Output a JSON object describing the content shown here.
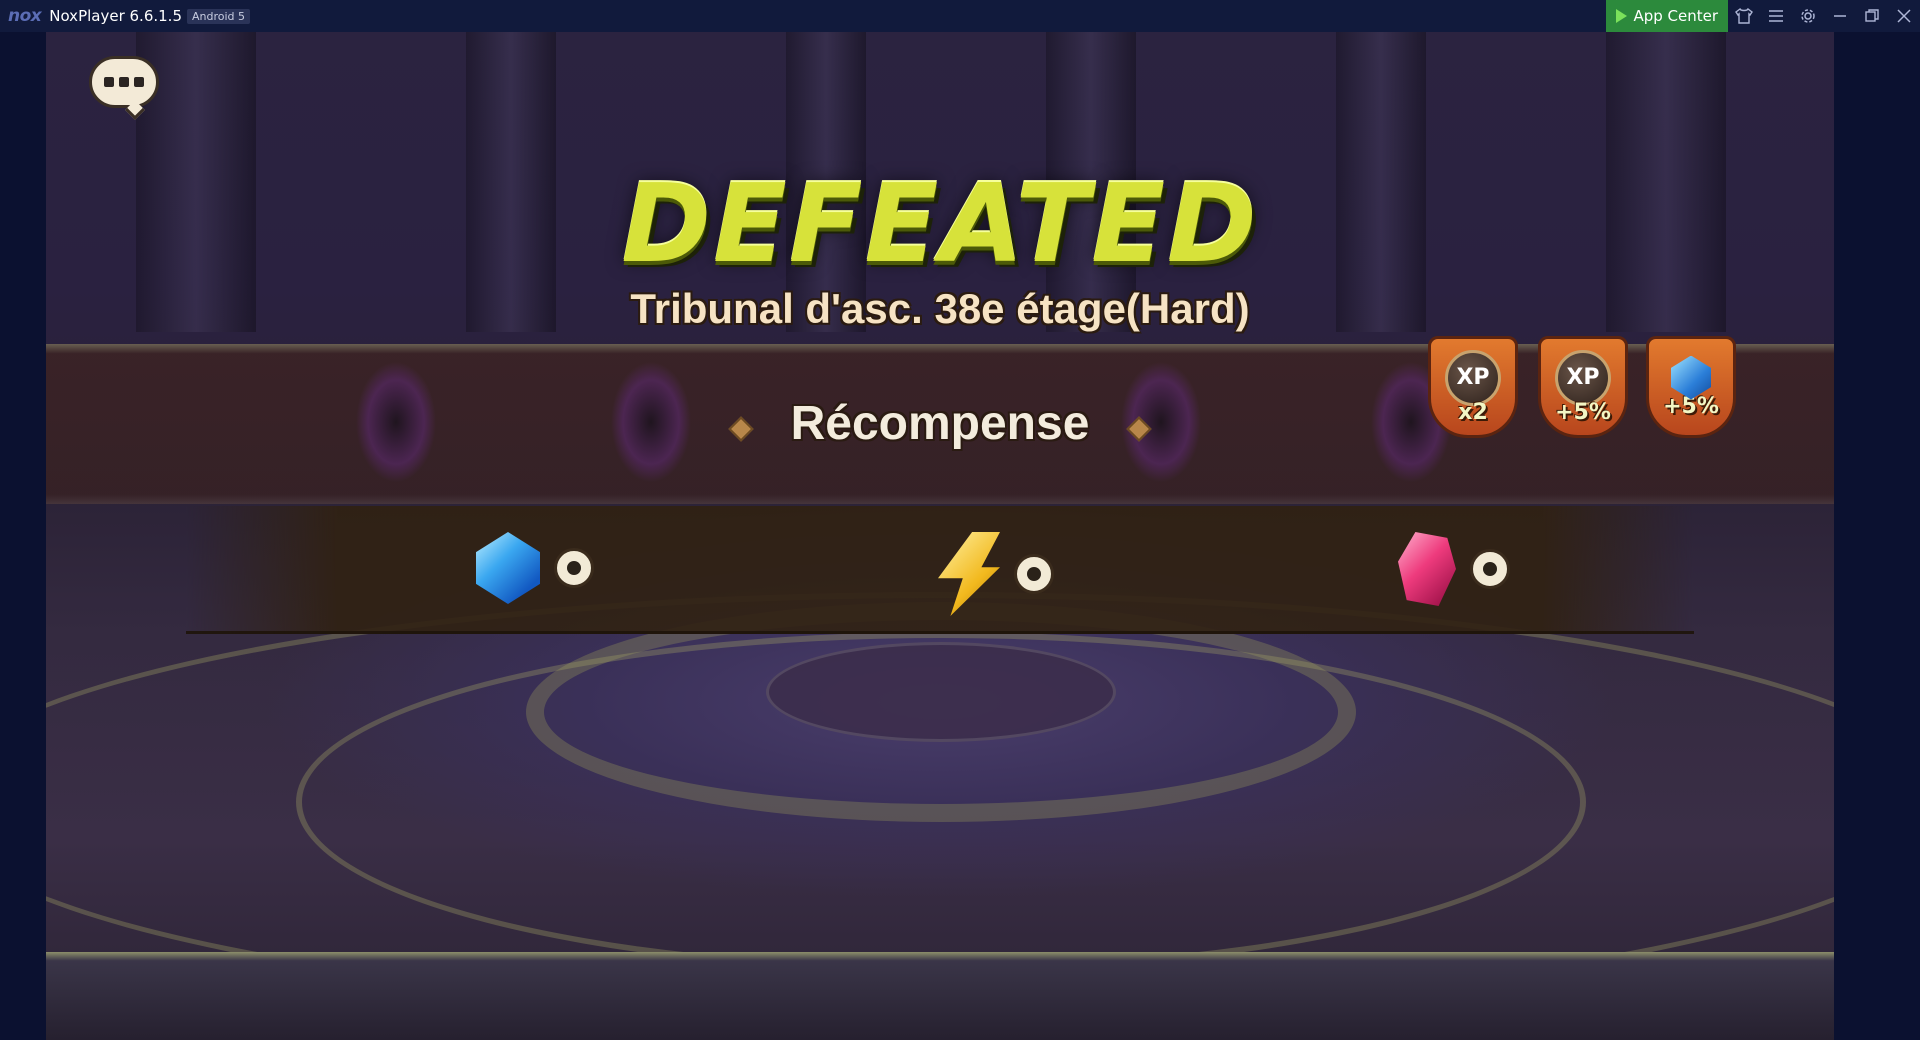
{
  "window": {
    "app_name": "NoxPlayer 6.6.1.5",
    "android_badge": "Android 5",
    "logo_text": "nox",
    "app_center_label": "App Center"
  },
  "game": {
    "result_title": "DEFEATED",
    "stage_name": "Tribunal d'asc. 38e étage(Hard)",
    "reward_title": "Récompense",
    "bonuses": [
      {
        "icon": "xp-icon",
        "top": "XP",
        "sub": "x2"
      },
      {
        "icon": "xp-icon",
        "top": "XP",
        "sub": "+5%"
      },
      {
        "icon": "crystal-icon",
        "top": "",
        "sub": "+5%"
      }
    ],
    "rewards": [
      {
        "icon": "blue-crystal-icon"
      },
      {
        "icon": "energy-bolt-icon"
      },
      {
        "icon": "pink-crystal-icon"
      }
    ]
  },
  "colors": {
    "title_bar": "#111a3c",
    "app_center": "#2c8a3c",
    "defeated_text": "#d7e23a"
  }
}
